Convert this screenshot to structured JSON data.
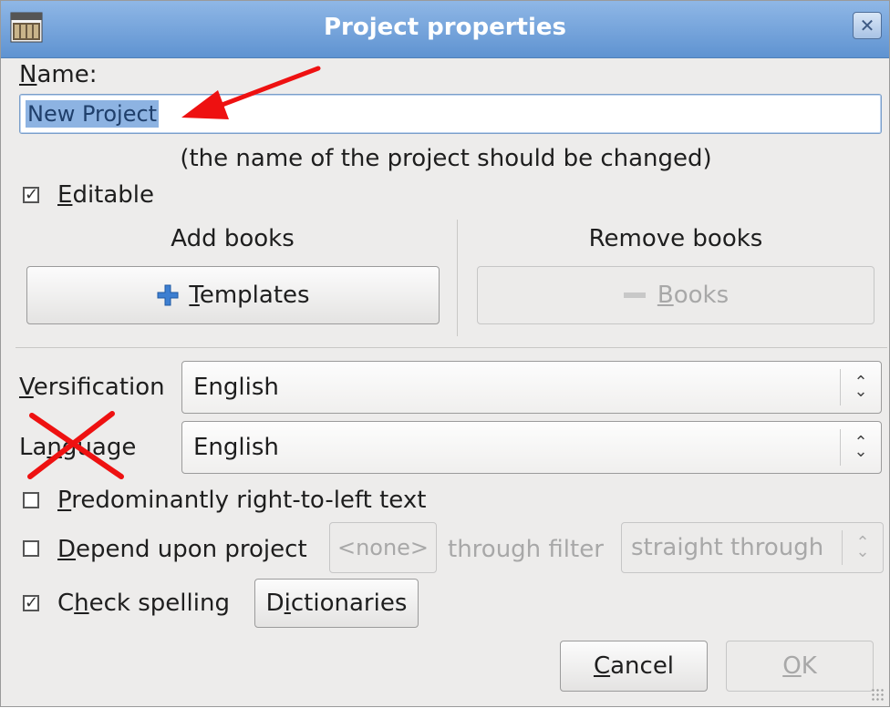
{
  "window": {
    "title": "Project properties"
  },
  "name_section": {
    "label": "Name:",
    "value": "New Project",
    "hint": "(the name of the project should be changed)"
  },
  "editable": {
    "label": "Editable",
    "checked": true
  },
  "add_books": {
    "heading": "Add books",
    "button": "Templates"
  },
  "remove_books": {
    "heading": "Remove books",
    "button": "Books"
  },
  "versification": {
    "label": "Versification",
    "value": "English"
  },
  "language": {
    "label": "Language",
    "value": "English"
  },
  "rtl": {
    "label": "Predominantly right-to-left text",
    "checked": false
  },
  "depend": {
    "label": "Depend upon project",
    "checked": false,
    "project_value": "<none>",
    "filter_label": "through filter",
    "filter_value": "straight through"
  },
  "spelling": {
    "label": "Check spelling",
    "checked": true,
    "dictionaries_button": "Dictionaries"
  },
  "footer": {
    "cancel": "Cancel",
    "ok": "OK"
  },
  "annotations": {
    "arrow_color": "#ee1111",
    "cross_color": "#ee1111"
  },
  "colors": {
    "titlebar": "#6f9fd8",
    "selection": "#8db3e2"
  }
}
